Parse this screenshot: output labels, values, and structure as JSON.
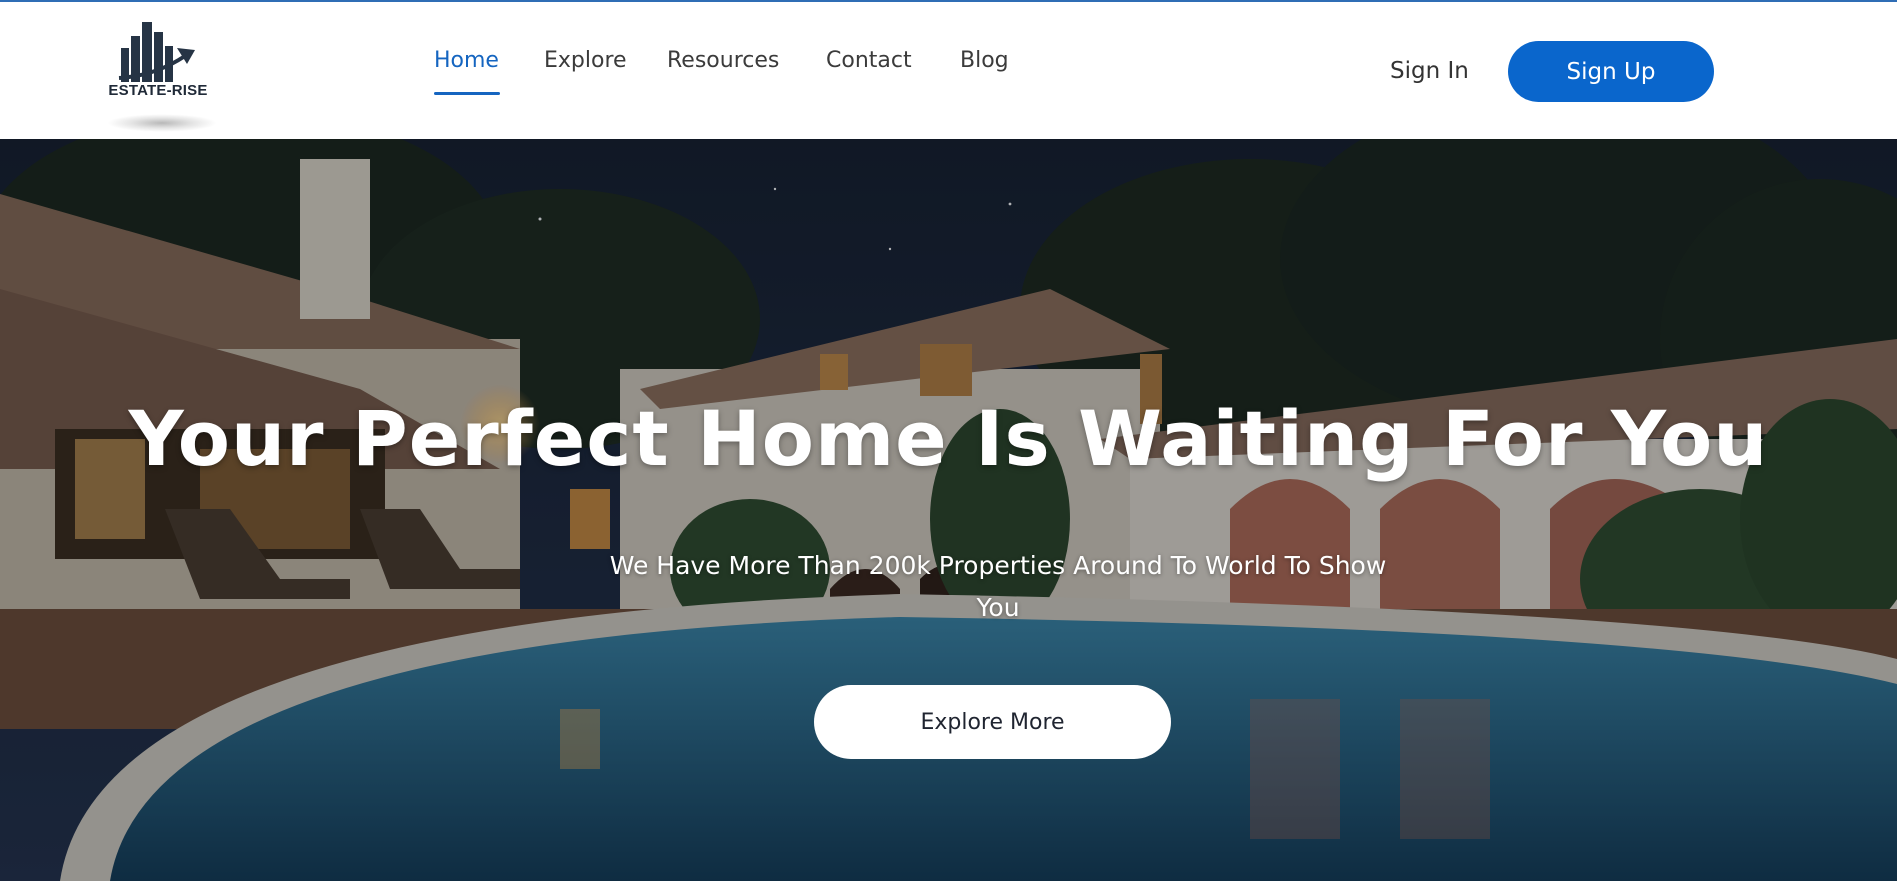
{
  "brand": {
    "name": "ESTATE-RISE",
    "logo_icon": "building-arrow-icon"
  },
  "nav": {
    "items": [
      {
        "label": "Home",
        "active": true
      },
      {
        "label": "Explore",
        "active": false
      },
      {
        "label": "Resources",
        "active": false
      },
      {
        "label": "Contact",
        "active": false
      },
      {
        "label": "Blog",
        "active": false
      }
    ]
  },
  "auth": {
    "sign_in_label": "Sign In",
    "sign_up_label": "Sign Up"
  },
  "hero": {
    "title": "Your Perfect Home Is Waiting For You",
    "subtitle": "We Have More Than 200k Properties Around To World To Show You",
    "cta_label": "Explore More"
  },
  "colors": {
    "accent": "#0a66cc",
    "nav_active": "#1565c0",
    "text_dark": "#3b3b3b"
  }
}
